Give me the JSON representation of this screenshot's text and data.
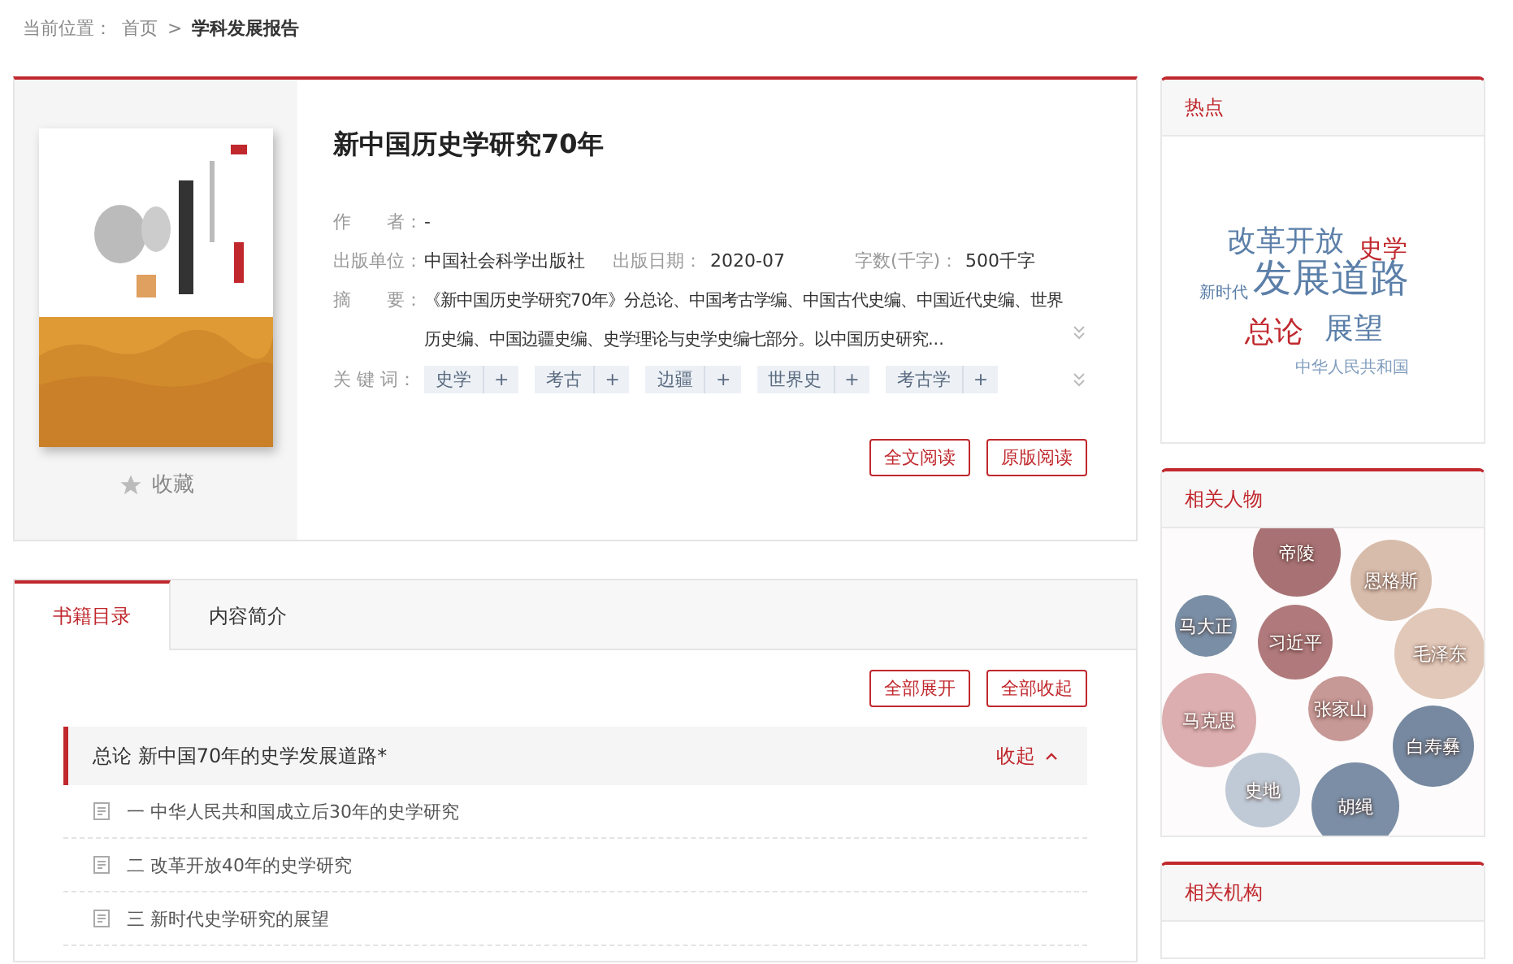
{
  "breadcrumb": {
    "label": "当前位置：",
    "items": [
      "首页",
      ">",
      "学科发展报告"
    ]
  },
  "book": {
    "title": "新中国历史学研究70年",
    "favorite": "收藏",
    "author": {
      "label": "作　　者：",
      "value": "-"
    },
    "meta": [
      {
        "label": "出版单位：",
        "value": "中国社会科学出版社"
      },
      {
        "label": "出版日期：",
        "value": "2020-07"
      },
      {
        "label": "字数(千字)：",
        "value": "500千字"
      }
    ],
    "abstract": {
      "label": "摘　　要：",
      "value": "《新中国历史学研究70年》分总论、中国考古学编、中国古代史编、中国近代史编、世界历史编、中国边疆史编、史学理论与史学史编七部分。以中国历史研究..."
    },
    "keywords": {
      "label": "关 键 词：",
      "items": [
        {
          "text": "史学",
          "add": "+"
        },
        {
          "text": "考古",
          "add": "+"
        },
        {
          "text": "边疆",
          "add": "+"
        },
        {
          "text": "世界史",
          "add": "+"
        },
        {
          "text": "考古学",
          "add": "+"
        }
      ]
    },
    "buttons": [
      "全文阅读",
      "原版阅读"
    ]
  },
  "tabs": [
    {
      "label": "书籍目录",
      "selected": true
    },
    {
      "label": "内容简介",
      "selected": false
    }
  ],
  "toc_buttons": [
    "全部展开",
    "全部收起"
  ],
  "toc": [
    {
      "title": "总论 新中国70年的史学发展道路*",
      "toggle": "收起",
      "expanded": true,
      "children": [
        {
          "title": "一 中华人民共和国成立后30年的史学研究"
        },
        {
          "title": "二 改革开放40年的史学研究"
        },
        {
          "title": "三 新时代史学研究的展望"
        }
      ]
    }
  ],
  "hot": {
    "title": "热点",
    "words": [
      {
        "text": "改革开放",
        "color": "#5b7fa8",
        "kind": "medium"
      },
      {
        "text": "史学",
        "color": "#c0282d",
        "kind": "small"
      },
      {
        "text": "新时代",
        "color": "#5b7fa8",
        "kind": "tiny"
      },
      {
        "text": "发展道路",
        "color": "#5b7fa8",
        "kind": "large"
      },
      {
        "text": "总论",
        "color": "#c0282d",
        "kind": "medium"
      },
      {
        "text": "展望",
        "color": "#5b7fa8",
        "kind": "medium"
      },
      {
        "text": "中华人民共和国",
        "color": "#7f9cbd",
        "kind": "tiny"
      }
    ]
  },
  "people": {
    "title": "相关人物",
    "items": [
      {
        "name": "帝陵",
        "color": "#a87274"
      },
      {
        "name": "恩格斯",
        "color": "#d8bcab"
      },
      {
        "name": "马大正",
        "color": "#7a8fa6"
      },
      {
        "name": "习近平",
        "color": "#b07a7c"
      },
      {
        "name": "毛泽东",
        "color": "#e2c8b8"
      },
      {
        "name": "马克思",
        "color": "#dcaeb0"
      },
      {
        "name": "张家山",
        "color": "#c69896"
      },
      {
        "name": "白寿彝",
        "color": "#7689a0"
      },
      {
        "name": "史地",
        "color": "#c0cad6"
      },
      {
        "name": "胡绳",
        "color": "#7b8ea5"
      }
    ]
  },
  "orgs": {
    "title": "相关机构"
  }
}
